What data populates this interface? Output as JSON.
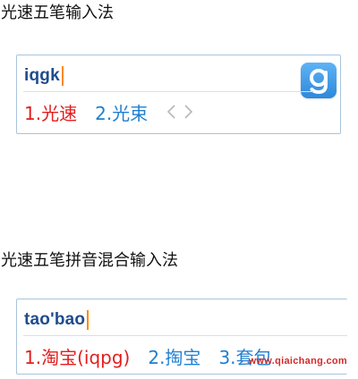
{
  "sections": [
    {
      "heading": "光速五笔输入法",
      "composition": "iqgk",
      "candidates": [
        {
          "label": "1.光速"
        },
        {
          "label": "2.光束"
        }
      ]
    },
    {
      "heading": "光速五笔拼音混合输入法",
      "composition": "tao'bao",
      "candidates": [
        {
          "label": "1.淘宝(iqpg)"
        },
        {
          "label": "2.掏宝"
        },
        {
          "label": "3.套包"
        }
      ]
    }
  ],
  "watermark": "www.qiaichang.com",
  "colors": {
    "first_candidate": "#e31d1d",
    "other_candidate": "#1f7fd0",
    "composition": "#1f4c8c",
    "caret": "#ff8a00",
    "border": "#a9c4dc",
    "logo": "#2d88db"
  },
  "icons": {
    "logo": "g-logo-icon",
    "prev": "chevron-left-icon",
    "next": "chevron-right-icon"
  }
}
